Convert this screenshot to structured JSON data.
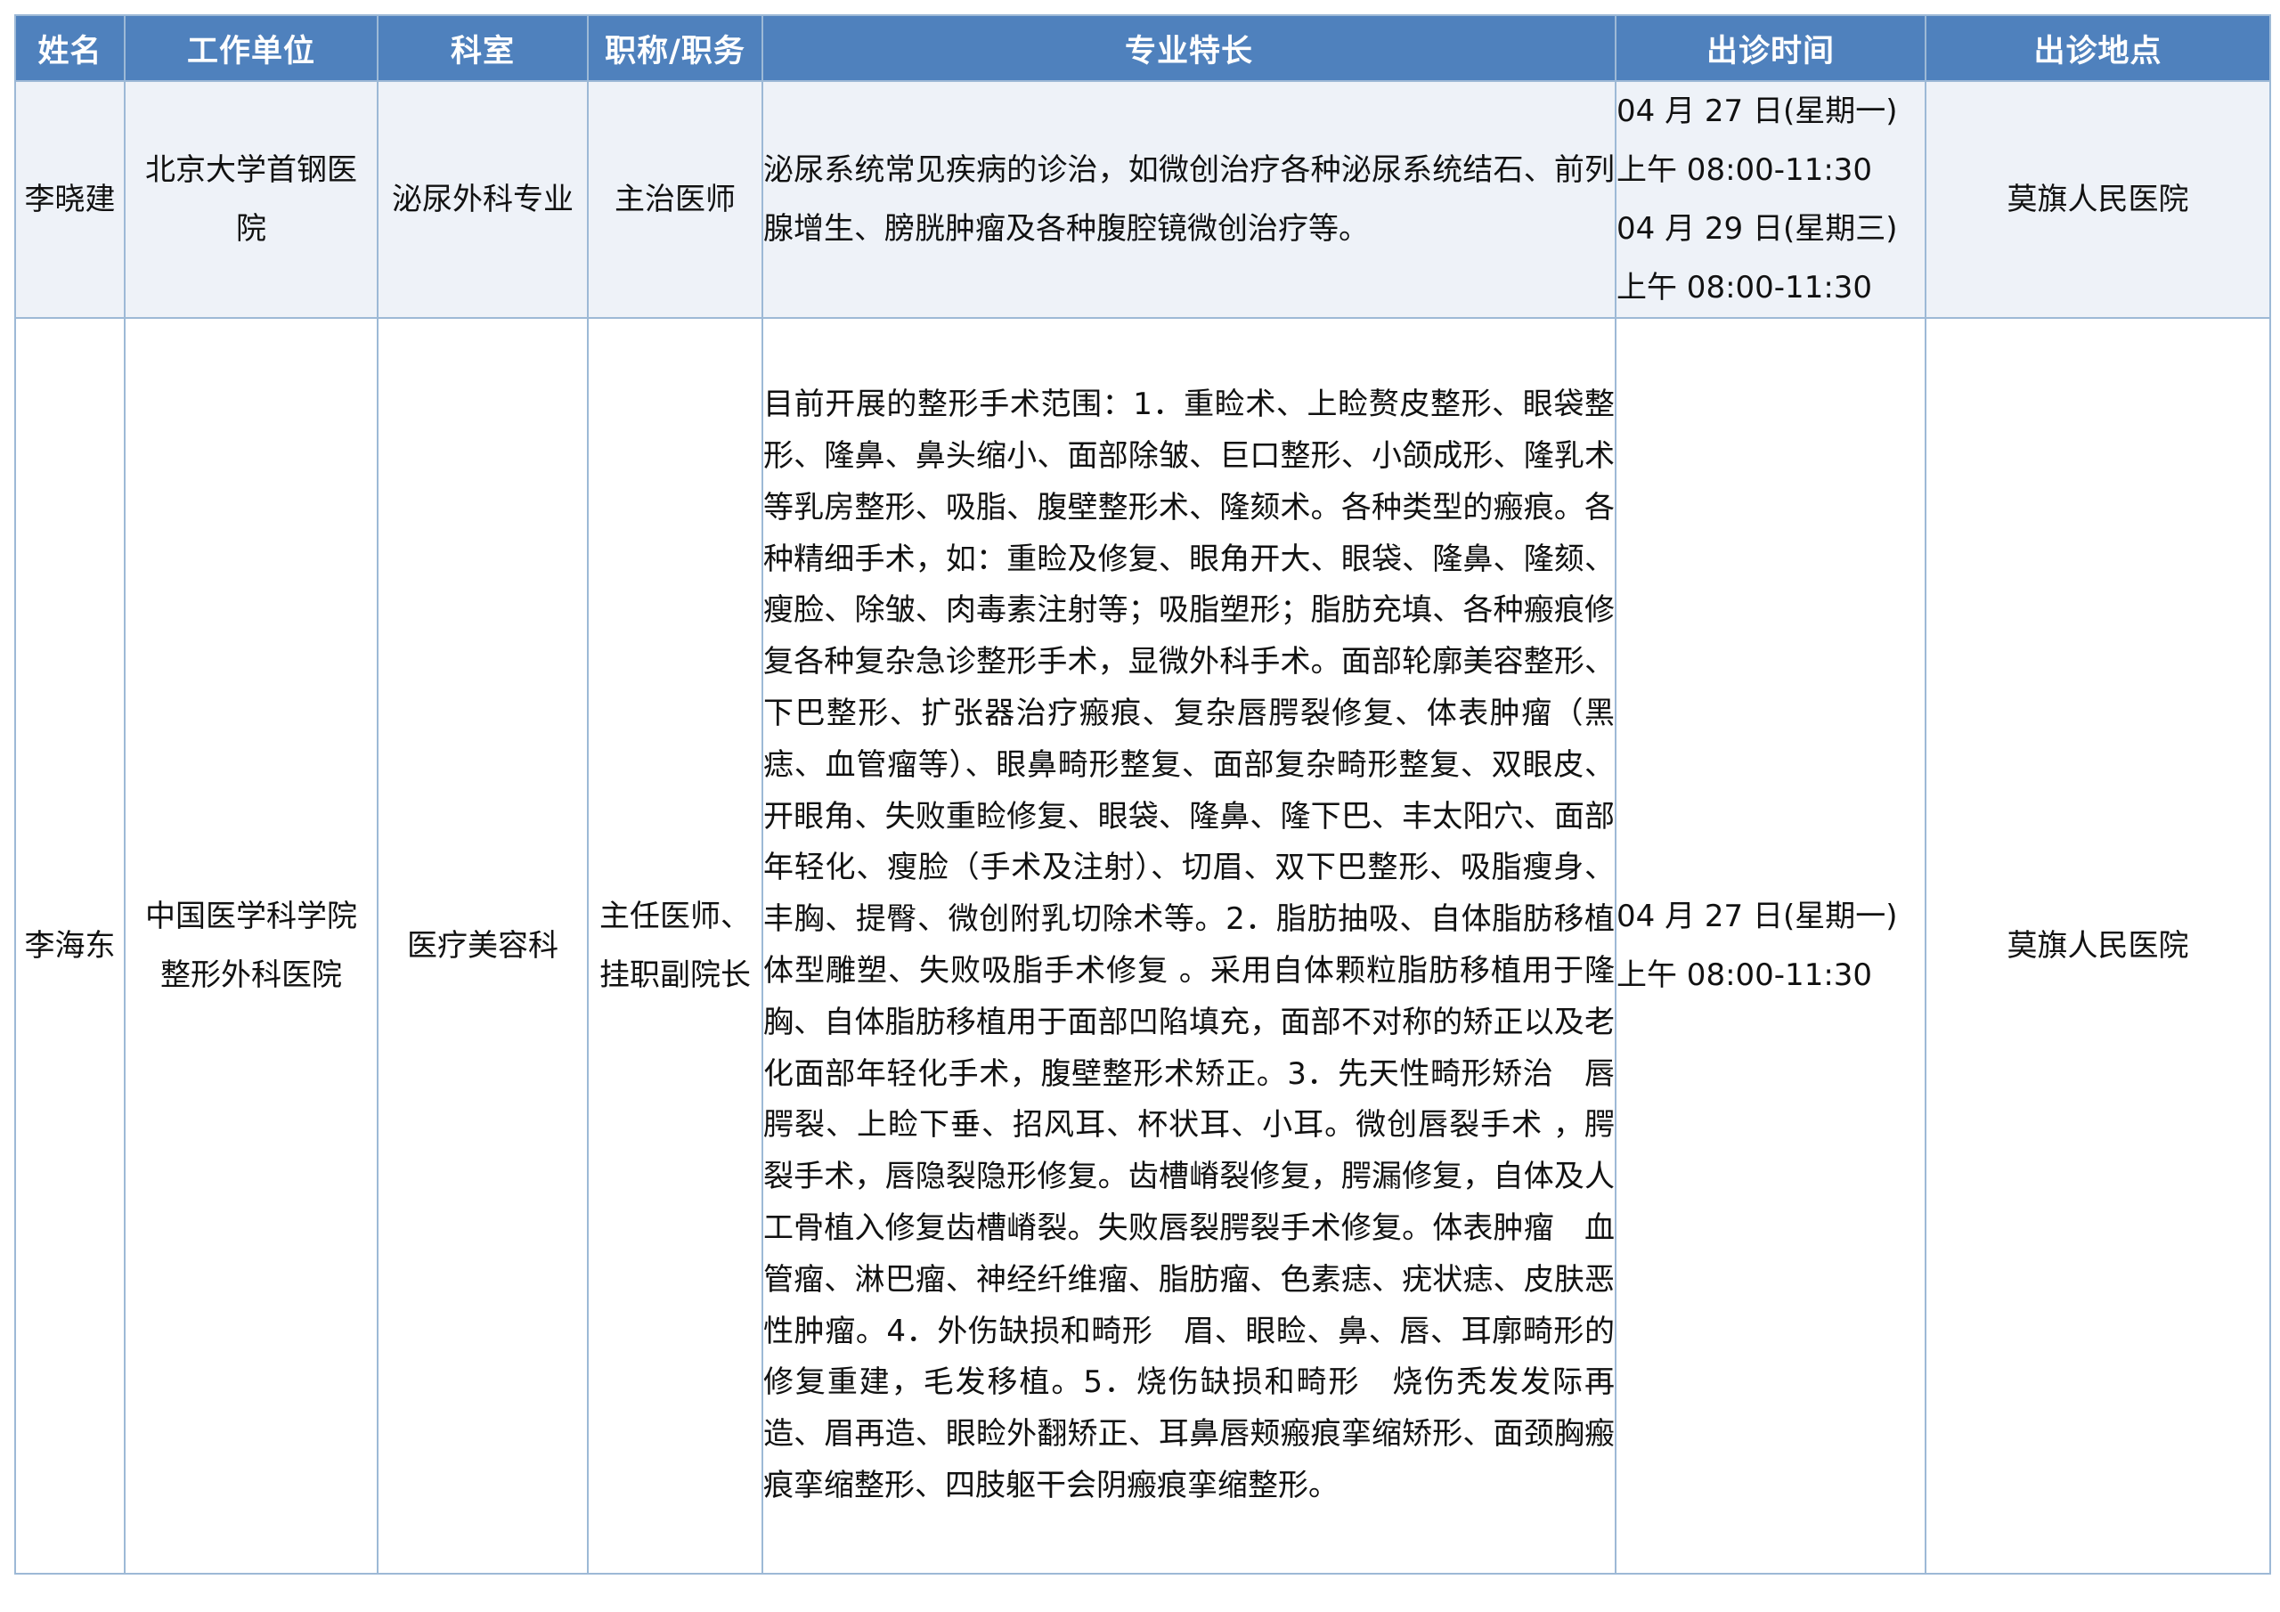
{
  "table": {
    "headers": [
      "姓名",
      "工作单位",
      "科室",
      "职称/职务",
      "专业特长",
      "出诊时间",
      "出诊地点"
    ],
    "rows": [
      {
        "name": "李晓建",
        "unit": "北京大学首钢医院",
        "department": "泌尿外科专业",
        "title": "主治医师",
        "specialty": "泌尿系统常见疾病的诊治，如微创治疗各种泌尿系统结石、前列腺增生、膀胱肿瘤及各种腹腔镜微创治疗等。",
        "times": [
          "04 月 27 日(星期一)",
          "上午 08:00-11:30",
          "04 月 29 日(星期三)",
          "上午 08:00-11:30"
        ],
        "location": "莫旗人民医院"
      },
      {
        "name": "李海东",
        "unit": "中国医学科学院整形外科医院",
        "department": "医疗美容科",
        "title": "主任医师、挂职副院长",
        "specialty": "目前开展的整形手术范围：1．重睑术、上睑赘皮整形、眼袋整形、隆鼻、鼻头缩小、面部除皱、巨口整形、小颌成形、隆乳术等乳房整形、吸脂、腹壁整形术、隆颏术。各种类型的瘢痕。各种精细手术，如：重睑及修复、眼角开大、眼袋、隆鼻、隆颏、瘦脸、除皱、肉毒素注射等；吸脂塑形；脂肪充填、各种瘢痕修复各种复杂急诊整形手术，显微外科手术。面部轮廓美容整形、下巴整形、扩张器治疗瘢痕、复杂唇腭裂修复、体表肿瘤（黑痣、血管瘤等）、眼鼻畸形整复、面部复杂畸形整复、双眼皮、开眼角、失败重睑修复、眼袋、隆鼻、隆下巴、丰太阳穴、面部年轻化、瘦脸（手术及注射）、切眉、双下巴整形、吸脂瘦身、丰胸、提臀、微创附乳切除术等。2．脂肪抽吸、自体脂肪移植体型雕塑、失败吸脂手术修复 。采用自体颗粒脂肪移植用于隆胸、自体脂肪移植用于面部凹陷填充，面部不对称的矫正以及老化面部年轻化手术，腹壁整形术矫正。3．先天性畸形矫治　唇腭裂、上睑下垂、招风耳、杯状耳、小耳。微创唇裂手术 ，腭裂手术，唇隐裂隐形修复。齿槽嵴裂修复，腭漏修复，自体及人工骨植入修复齿槽嵴裂。失败唇裂腭裂手术修复。体表肿瘤　血管瘤、淋巴瘤、神经纤维瘤、脂肪瘤、色素痣、疣状痣、皮肤恶性肿瘤。4．外伤缺损和畸形　眉、眼睑、鼻、唇、耳廓畸形的修复重建，毛发移植。5．烧伤缺损和畸形　烧伤秃发发际再造、眉再造、眼睑外翻矫正、耳鼻唇颊瘢痕挛缩矫形、面颈胸瘢痕挛缩整形、四肢躯干会阴瘢痕挛缩整形。",
        "times": [
          "04 月 27 日(星期一)",
          "上午 08:00-11:30"
        ],
        "location": "莫旗人民医院"
      }
    ]
  },
  "colors": {
    "header_bg": "#4f81bd",
    "header_text": "#ffffff",
    "border": "#9db9d6",
    "row1_bg": "#eef2f8"
  }
}
